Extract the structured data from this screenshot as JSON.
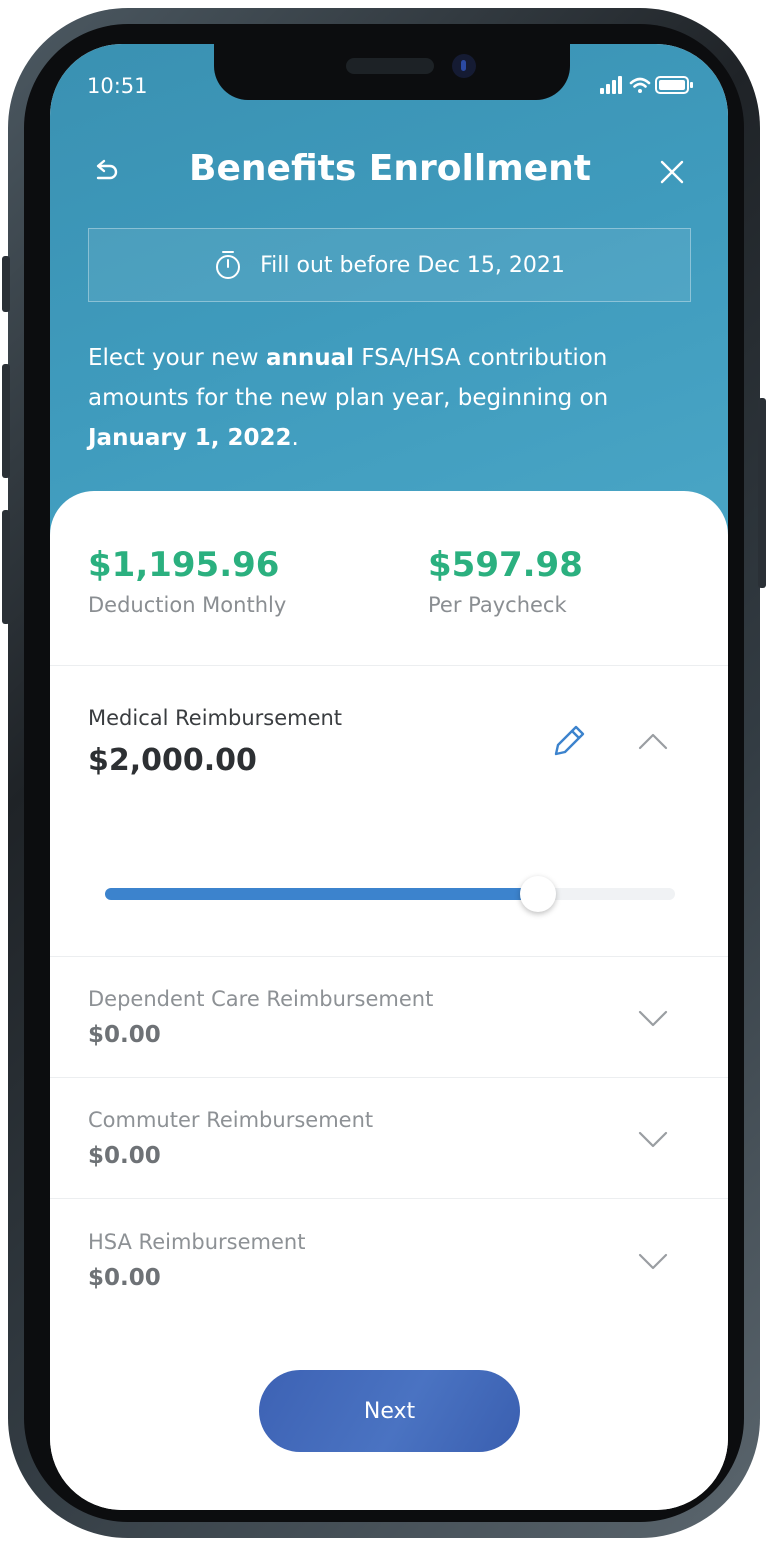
{
  "status_bar": {
    "time": "10:51"
  },
  "header": {
    "title": "Benefits Enrollment",
    "deadline": "Fill out before Dec 15, 2021",
    "intro_part1": "Elect your new ",
    "intro_bold1": "annual",
    "intro_part2": " FSA/HSA contribution amounts for the new plan year, beginning on ",
    "intro_bold2": "January 1, 2022",
    "intro_part3": "."
  },
  "summary": {
    "monthly_amount": "$1,195.96",
    "monthly_label": "Deduction Monthly",
    "paycheck_amount": "$597.98",
    "paycheck_label": "Per Paycheck"
  },
  "medical": {
    "title": "Medical Reimbursement",
    "amount": "$2,000.00",
    "slider_fraction": 0.76
  },
  "accounts": [
    {
      "title": "Dependent Care Reimbursement",
      "amount": "$0.00"
    },
    {
      "title": "Commuter Reimbursement",
      "amount": "$0.00"
    },
    {
      "title": "HSA Reimbursement",
      "amount": "$0.00"
    }
  ],
  "actions": {
    "next_label": "Next"
  },
  "colors": {
    "header_bg": "#3f9bbd",
    "accent_green": "#2bb07f",
    "slider_blue": "#3c83cd",
    "button_blue": "#4468b8"
  }
}
